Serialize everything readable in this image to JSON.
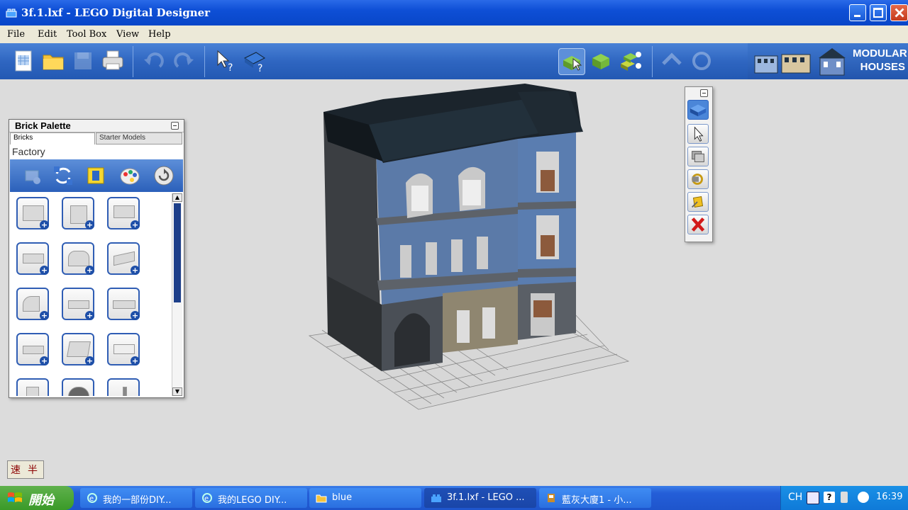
{
  "window": {
    "title": "3f.1.lxf - LEGO Digital Designer",
    "app_icon": "lego-brick-icon",
    "controls": [
      "minimize-icon",
      "maximize-icon",
      "close-icon"
    ]
  },
  "menu": {
    "file": "File",
    "edit": "Edit",
    "toolbox": "Tool Box",
    "view": "View",
    "help": "Help"
  },
  "toolbar": {
    "icons": [
      "new-file-icon",
      "open-folder-icon",
      "save-icon",
      "print-icon",
      "undo-icon",
      "redo-icon",
      "help-pointer-icon",
      "help-book-icon",
      "build-mode-icon",
      "view-mode-icon",
      "building-guide-mode-icon",
      "hinge-tool-icon",
      "rotate-tool-icon"
    ],
    "theme_label_line1": "MODULAR",
    "theme_label_line2": "HOUSES"
  },
  "brick_palette": {
    "title": "Brick Palette",
    "tabs": [
      "Bricks",
      "Starter Models"
    ],
    "category": "Factory",
    "tool_icons": [
      "add-brick-icon",
      "swap-icon",
      "decorate-icon",
      "color-palette-icon",
      "reset-icon"
    ],
    "plus_glyph": "+",
    "scroll_up": "▲",
    "scroll_down": "▼"
  },
  "tool_palette": {
    "icons": [
      "brick-icon",
      "select-arrow-icon",
      "clone-icon",
      "hinge-icon",
      "paint-bucket-icon",
      "delete-icon"
    ]
  },
  "ime": {
    "char1": "速",
    "char2": "半"
  },
  "taskbar": {
    "start": "開始",
    "tasks": [
      {
        "label": "我的一部份DIY...",
        "active": false
      },
      {
        "label": "我的LEGO DIY...",
        "active": false
      },
      {
        "label": "blue",
        "active": false
      },
      {
        "label": "3f.1.lxf - LEGO ...",
        "active": true
      },
      {
        "label": "藍灰大廈1 - 小...",
        "active": false
      }
    ],
    "tray_lang": "CH",
    "clock": "16:39"
  },
  "colors": {
    "accent": "#2f66c1",
    "titlebar": "#0e4fd6",
    "house_blue": "#5b7aa8"
  }
}
